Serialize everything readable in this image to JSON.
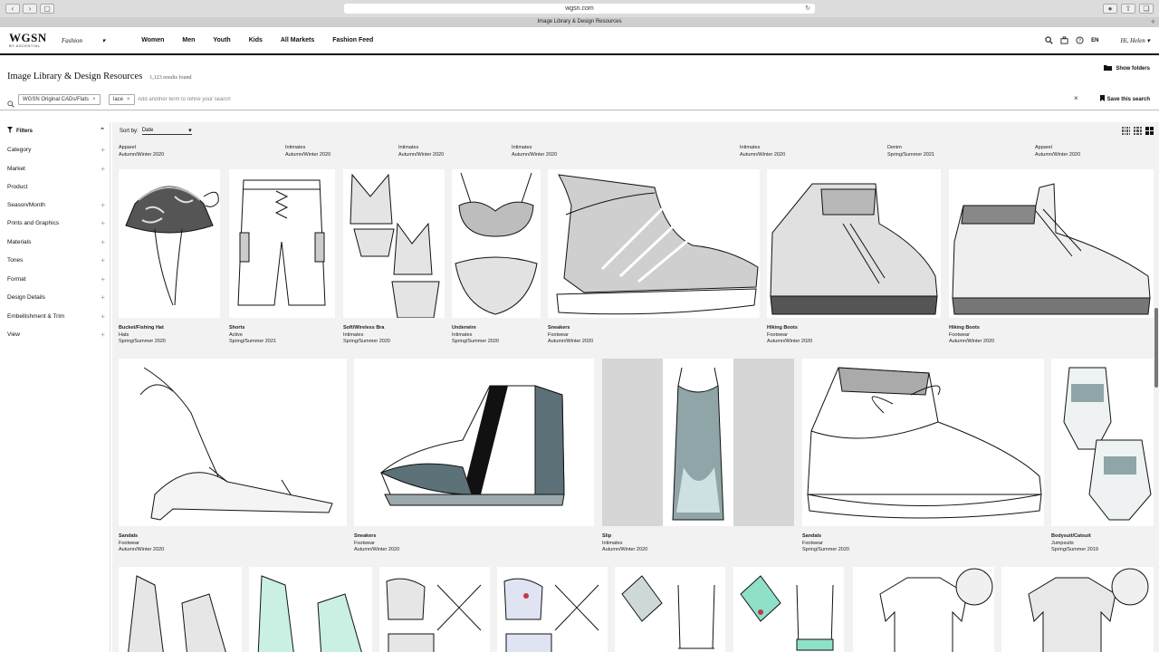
{
  "browser": {
    "url": "wgsn.com",
    "tab_title": "Image Library & Design Resources"
  },
  "header": {
    "logo_main": "WGSN",
    "logo_sub": "BY ASCENTIAL",
    "nav": [
      "Fashion",
      "Women",
      "Men",
      "Youth",
      "Kids",
      "All Markets",
      "Fashion Feed"
    ],
    "language": "EN",
    "greeting": "Hi, Helen"
  },
  "page": {
    "title": "Image Library & Design Resources",
    "results": "1,123 results found",
    "show_folders": "Show folders"
  },
  "search": {
    "chips": [
      "WGSN Original CADs/Flats",
      "lace"
    ],
    "placeholder": "Add another term to refine your search",
    "save_label": "Save this search"
  },
  "sidebar": {
    "title": "Filters",
    "items": [
      "Category",
      "Market",
      "Product",
      "Season/Month",
      "Prints and Graphics",
      "Materials",
      "Tones",
      "Format",
      "Design Details",
      "Embellishment & Trim",
      "View"
    ]
  },
  "sort": {
    "label": "Sort by:",
    "value": "Date"
  },
  "top_meta": [
    {
      "cat": "Apparel",
      "season": "Autumn/Winter 2020"
    },
    {
      "cat": "Intimates",
      "season": "Autumn/Winter 2020"
    },
    {
      "cat": "Intimates",
      "season": "Autumn/Winter 2020"
    },
    {
      "cat": "Intimates",
      "season": "Autumn/Winter 2020"
    },
    {
      "cat": "Intimates",
      "season": "Autumn/Winter 2020"
    },
    {
      "cat": "Denim",
      "season": "Spring/Summer 2021"
    },
    {
      "cat": "Apparel",
      "season": "Autumn/Winter 2020"
    }
  ],
  "row1": [
    {
      "title": "Bucket/Fishing Hat",
      "cat": "Hats",
      "season": "Spring/Summer 2020"
    },
    {
      "title": "Shorts",
      "cat": "Active",
      "season": "Spring/Summer 2021"
    },
    {
      "title": "Soft/Wireless Bra",
      "cat": "Intimates",
      "season": "Spring/Summer 2020"
    },
    {
      "title": "Underwire",
      "cat": "Intimates",
      "season": "Spring/Summer 2020"
    },
    {
      "title": "Sneakers",
      "cat": "Footwear",
      "season": "Autumn/Winter 2020"
    },
    {
      "title": "Hiking Boots",
      "cat": "Footwear",
      "season": "Autumn/Winter 2020"
    },
    {
      "title": "Hiking Boots",
      "cat": "Footwear",
      "season": "Autumn/Winter 2020"
    }
  ],
  "row2": [
    {
      "title": "Sandals",
      "cat": "Footwear",
      "season": "Autumn/Winter 2020"
    },
    {
      "title": "Sneakers",
      "cat": "Footwear",
      "season": "Autumn/Winter 2020"
    },
    {
      "title": "Slip",
      "cat": "Intimates",
      "season": "Autumn/Winter 2020"
    },
    {
      "title": "Sandals",
      "cat": "Footwear",
      "season": "Spring/Summer 2020"
    },
    {
      "title": "Bodysuit/Catsuit",
      "cat": "Jumpsuits",
      "season": "Spring/Summer 2019"
    }
  ],
  "colors": {
    "accent": "#111111",
    "grid_bg": "#f2f2f2",
    "mint": "#8fe0c8",
    "slate": "#5d7278"
  }
}
